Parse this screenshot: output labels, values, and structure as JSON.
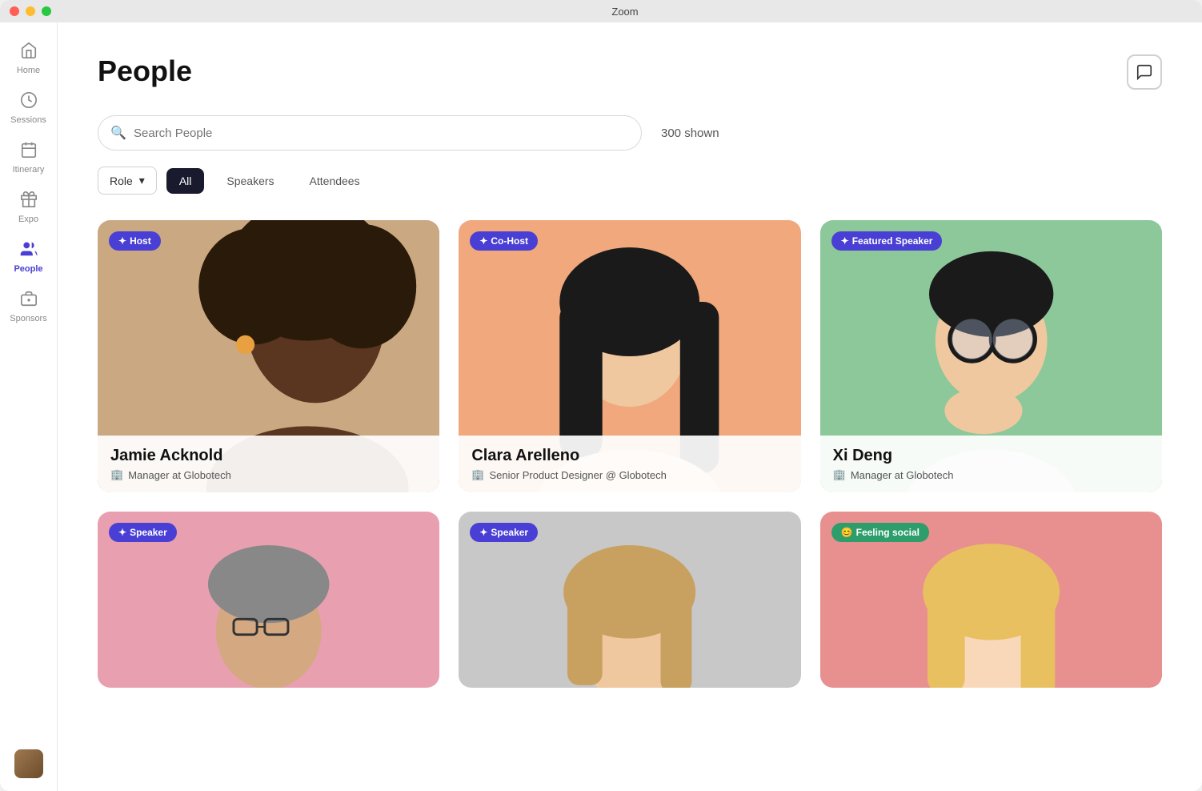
{
  "titlebar": {
    "title": "Zoom"
  },
  "sidebar": {
    "items": [
      {
        "id": "home",
        "label": "Home",
        "icon": "🏠",
        "active": false
      },
      {
        "id": "sessions",
        "label": "Sessions",
        "icon": "🕐",
        "active": false
      },
      {
        "id": "itinerary",
        "label": "Itinerary",
        "icon": "📋",
        "active": false
      },
      {
        "id": "expo",
        "label": "Expo",
        "icon": "🎁",
        "active": false
      },
      {
        "id": "people",
        "label": "People",
        "icon": "👥",
        "active": true
      },
      {
        "id": "sponsors",
        "label": "Sponsors",
        "icon": "🎀",
        "active": false
      }
    ]
  },
  "header": {
    "title": "People",
    "chat_icon": "chat"
  },
  "search": {
    "placeholder": "Search People",
    "shown_count": "300 shown"
  },
  "filters": {
    "role_label": "Role",
    "tabs": [
      {
        "id": "all",
        "label": "All",
        "active": true
      },
      {
        "id": "speakers",
        "label": "Speakers",
        "active": false
      },
      {
        "id": "attendees",
        "label": "Attendees",
        "active": false
      }
    ]
  },
  "people": [
    {
      "id": 1,
      "badge": "Host",
      "badge_icon": "✦",
      "badge_color": "blue",
      "name": "Jamie Acknold",
      "role": "Manager at Globotech",
      "card_bg": "#d4b896",
      "photo_hint": "black woman profile"
    },
    {
      "id": 2,
      "badge": "Co-Host",
      "badge_icon": "✦",
      "badge_color": "blue",
      "name": "Clara Arelleno",
      "role": "Senior Product Designer @ Globotech",
      "card_bg": "#f0a87c",
      "photo_hint": "asian woman"
    },
    {
      "id": 3,
      "badge": "Featured Speaker",
      "badge_icon": "✦",
      "badge_color": "blue",
      "name": "Xi Deng",
      "role": "Manager at Globotech",
      "card_bg": "#8dc89a",
      "photo_hint": "asian man glasses"
    },
    {
      "id": 4,
      "badge": "Speaker",
      "badge_icon": "✦",
      "badge_color": "blue",
      "name": "",
      "role": "",
      "card_bg": "#e8a0b0",
      "photo_hint": "man glasses pink"
    },
    {
      "id": 5,
      "badge": "Speaker",
      "badge_icon": "✦",
      "badge_color": "blue",
      "name": "",
      "role": "",
      "card_bg": "#c8c8c8",
      "photo_hint": "woman gray"
    },
    {
      "id": 6,
      "badge": "Feeling social",
      "badge_icon": "😊",
      "badge_color": "green",
      "name": "",
      "role": "",
      "card_bg": "#e89090",
      "photo_hint": "woman salmon"
    }
  ]
}
